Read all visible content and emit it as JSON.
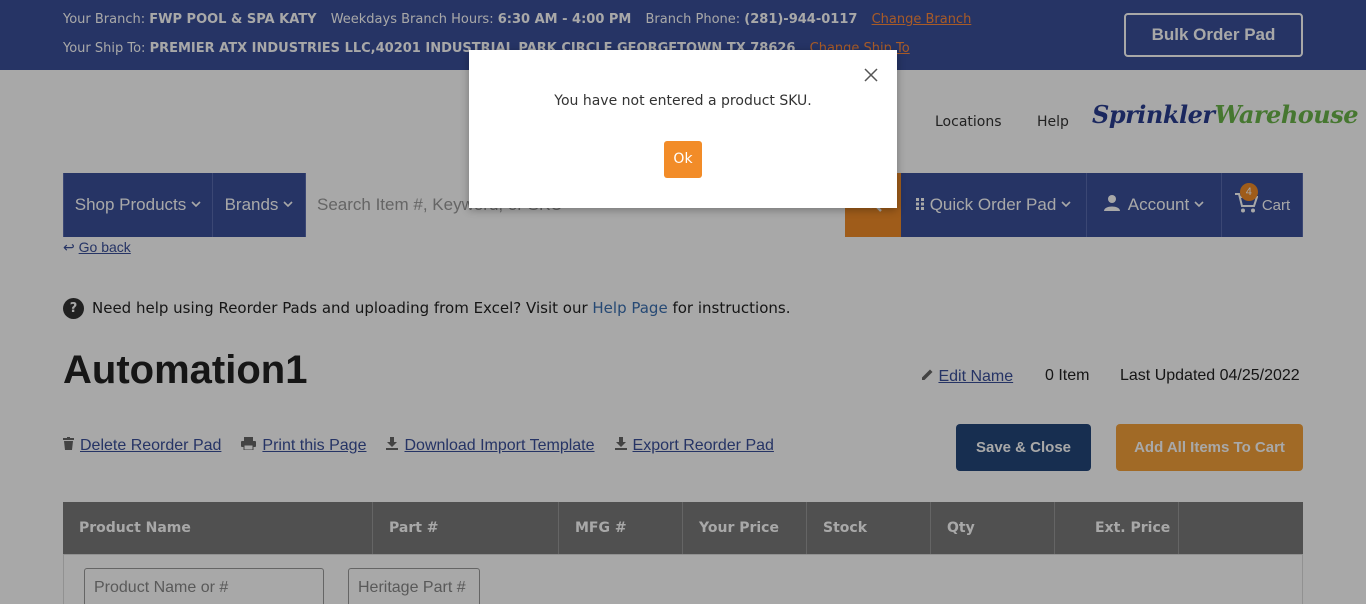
{
  "topbar": {
    "branch_label": "Your Branch:",
    "branch_value": "FWP POOL & SPA KATY",
    "hours_label": "Weekdays Branch Hours:",
    "hours_value": "6:30 AM - 4:00 PM",
    "phone_label": "Branch Phone:",
    "phone_value": "(281)-944-0117",
    "change_branch": "Change Branch",
    "shipto_label": "Your Ship To:",
    "shipto_value": "PREMIER ATX INDUSTRIES LLC,40201 INDUSTRIAL PARK CIRCLE GEORGETOWN TX 78626",
    "change_shipto": "Change Ship To",
    "bulk_order": "Bulk Order Pad"
  },
  "header": {
    "locations": "Locations",
    "help": "Help",
    "logo_part1": "Sprinkler",
    "logo_part2": "Warehouse"
  },
  "nav": {
    "shop_products": "Shop Products",
    "brands": "Brands",
    "search_placeholder": "Search Item #, Keyword, or SKU",
    "quick_order": "Quick Order Pad",
    "account": "Account",
    "cart": "Cart",
    "cart_count": "4"
  },
  "main": {
    "go_back": "Go back",
    "help_text_before": "Need help using Reorder Pads and uploading from Excel? Visit our",
    "help_link": "Help Page",
    "help_text_after": "for instructions.",
    "title": "Automation1",
    "edit_name": "Edit Name",
    "item_count": "0 Item",
    "last_updated": "Last Updated 04/25/2022",
    "actions": {
      "delete": "Delete Reorder Pad",
      "print": "Print this Page",
      "download": "Download Import Template",
      "export": "Export Reorder Pad"
    },
    "save_close": "Save & Close",
    "add_all": "Add All Items To Cart"
  },
  "table": {
    "headers": [
      "Product Name",
      "Part #",
      "MFG #",
      "Your Price",
      "Stock",
      "Qty",
      "Ext. Price"
    ],
    "product_placeholder": "Product Name or #",
    "part_placeholder": "Heritage Part #"
  },
  "modal": {
    "message": "You have not entered a product SKU.",
    "ok": "Ok"
  },
  "colors": {
    "brand_blue": "#3a4f9a",
    "accent_orange": "#f28c28",
    "save_blue": "#24467a"
  }
}
